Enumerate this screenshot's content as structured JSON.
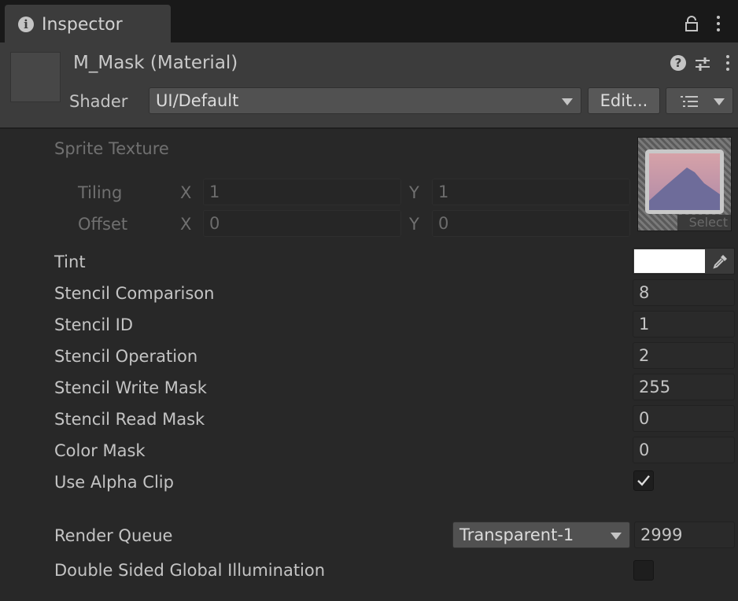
{
  "tab": {
    "title": "Inspector",
    "icon": "info-icon"
  },
  "header": {
    "material_name": "M_Mask (Material)",
    "shader_label": "Shader",
    "shader_value": "UI/Default",
    "edit_label": "Edit..."
  },
  "sprite_texture": {
    "label": "Sprite Texture",
    "tiling_label": "Tiling",
    "offset_label": "Offset",
    "x_label": "X",
    "y_label": "Y",
    "tiling_x": "1",
    "tiling_y": "1",
    "offset_x": "0",
    "offset_y": "0",
    "select_label": "Select"
  },
  "properties": [
    {
      "label": "Tint",
      "type": "color",
      "value": "#ffffff"
    },
    {
      "label": "Stencil Comparison",
      "type": "number",
      "value": "8"
    },
    {
      "label": "Stencil ID",
      "type": "number",
      "value": "1"
    },
    {
      "label": "Stencil Operation",
      "type": "number",
      "value": "2"
    },
    {
      "label": "Stencil Write Mask",
      "type": "number",
      "value": "255"
    },
    {
      "label": "Stencil Read Mask",
      "type": "number",
      "value": "0"
    },
    {
      "label": "Color Mask",
      "type": "number",
      "value": "0"
    },
    {
      "label": "Use Alpha Clip",
      "type": "checkbox",
      "checked": true
    }
  ],
  "render_queue": {
    "label": "Render Queue",
    "dropdown_value": "Transparent-1",
    "value": "2999"
  },
  "double_sided": {
    "label": "Double Sided Global Illumination",
    "checked": false
  },
  "colors": {
    "background": "#282828",
    "header": "#3c3c3c",
    "tabbar": "#191919",
    "field": "#2a2a2a"
  }
}
